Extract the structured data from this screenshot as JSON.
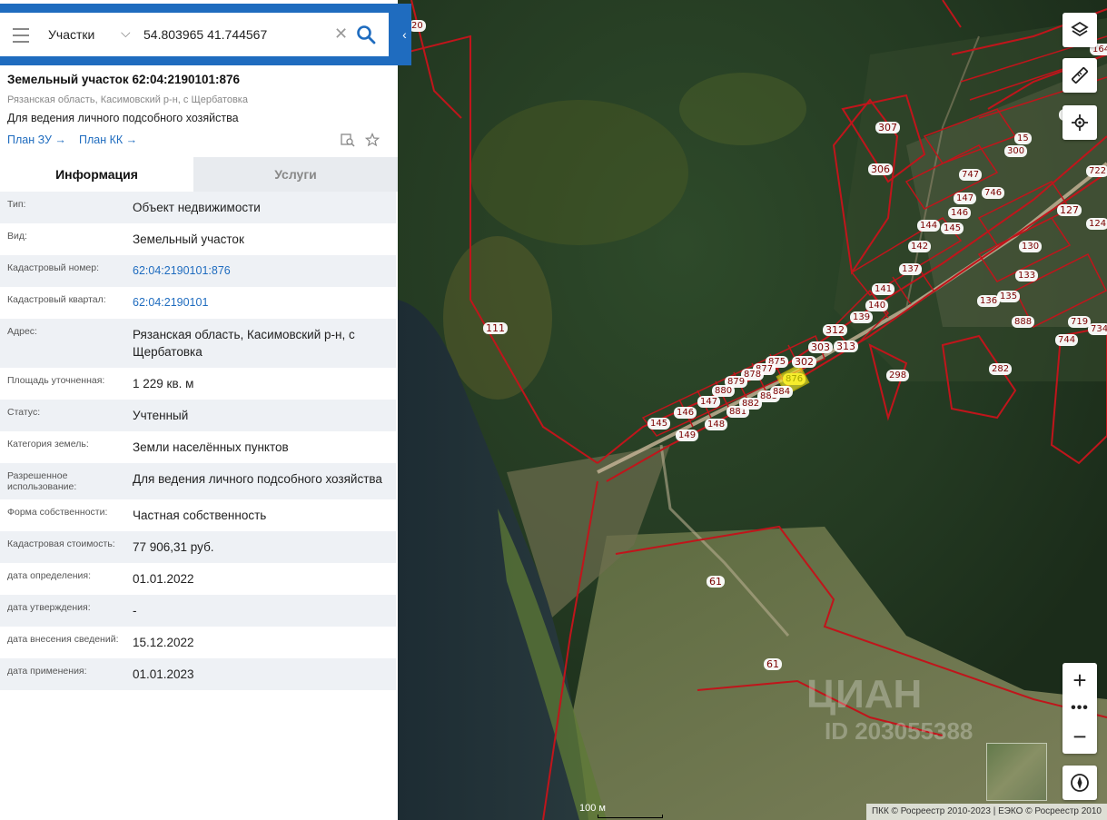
{
  "search": {
    "layer_select": "Участки",
    "query": "54.803965 41.744567"
  },
  "object": {
    "title": "Земельный участок 62:04:2190101:876",
    "address_short": "Рязанская область, Касимовский р-н, с Щербатовка",
    "purpose": "Для ведения личного подсобного хозяйства",
    "link_plan_zu": "План ЗУ →",
    "link_plan_kk": "План КК →"
  },
  "tabs": {
    "info": "Информация",
    "services": "Услуги"
  },
  "rows": [
    {
      "k": "Тип:",
      "v": "Объект недвижимости"
    },
    {
      "k": "Вид:",
      "v": "Земельный участок"
    },
    {
      "k": "Кадастровый номер:",
      "v": "62:04:2190101:876"
    },
    {
      "k": "Кадастровый квартал:",
      "v": "62:04:2190101"
    },
    {
      "k": "Адрес:",
      "v": "Рязанская область, Касимовский р-н, с Щербатовка"
    },
    {
      "k": "Площадь уточненная:",
      "v": "1 229 кв. м"
    },
    {
      "k": "Статус:",
      "v": "Учтенный"
    },
    {
      "k": "Категория земель:",
      "v": "Земли населённых пунктов"
    },
    {
      "k": "Разрешенное использование:",
      "v": "Для ведения личного подсобного хозяйства"
    },
    {
      "k": "Форма собственности:",
      "v": "Частная собственность"
    },
    {
      "k": "Кадастровая стоимость:",
      "v": "77 906,31 руб."
    },
    {
      "k": "дата определения:",
      "v": "01.01.2022"
    },
    {
      "k": "дата утверждения:",
      "v": "-"
    },
    {
      "k": "дата внесения сведений:",
      "v": "15.12.2022"
    },
    {
      "k": "дата применения:",
      "v": "01.01.2023"
    }
  ],
  "map": {
    "scale": "100 м",
    "attribution": "ПКК © Росреестр 2010-2023 | ЕЭКО © Росреестр 2010",
    "watermark_1": "ЦИАН",
    "watermark_2": "ID 203055388",
    "labels": [
      "20",
      "307",
      "306",
      "15",
      "300",
      "747",
      "746",
      "147",
      "146",
      "145",
      "144",
      "142",
      "137",
      "141",
      "140",
      "139",
      "312",
      "313",
      "303",
      "302",
      "875",
      "876",
      "877",
      "878",
      "879",
      "880",
      "881",
      "882",
      "883",
      "884",
      "147",
      "146",
      "145",
      "148",
      "149",
      "111",
      "61",
      "61",
      "127",
      "130",
      "133",
      "135",
      "136",
      "888",
      "744",
      "719",
      "734",
      "282",
      "298",
      "124",
      "722",
      "158",
      "164"
    ]
  },
  "colors": {
    "accent": "#1f6cbf",
    "parcel_border": "#c0151b",
    "highlight": "#f6ec2c"
  }
}
